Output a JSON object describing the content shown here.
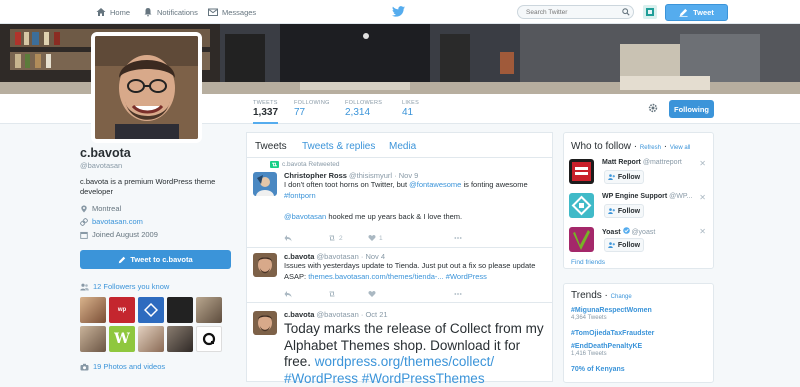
{
  "nav": {
    "home": "Home",
    "notifications": "Notifications",
    "messages": "Messages"
  },
  "search": {
    "placeholder": "Search Twitter"
  },
  "tweet_button": "Tweet",
  "stats": [
    {
      "label": "TWEETS",
      "value": "1,337"
    },
    {
      "label": "FOLLOWING",
      "value": "77"
    },
    {
      "label": "FOLLOWERS",
      "value": "2,314"
    },
    {
      "label": "LIKES",
      "value": "41"
    }
  ],
  "following_button": "Following",
  "profile": {
    "name": "c.bavota",
    "handle": "@bavotasan",
    "bio": "c.bavota is a premium WordPress theme developer",
    "location": "Montreal",
    "website": "bavotasan.com",
    "joined": "Joined August 2009",
    "tweet_to": "Tweet to c.bavota",
    "followers_you_know": "12 Followers you know",
    "photos_videos": "19 Photos and videos"
  },
  "tabs": [
    "Tweets",
    "Tweets & replies",
    "Media"
  ],
  "tweets": [
    {
      "retweeted_by": "c.bavota Retweeted",
      "name": "Christopher Ross",
      "handle": "@thisismyurl",
      "time": "Nov 9",
      "text_a": "I don't often toot horns on Twitter, but ",
      "link_a": "@fontawesome",
      "text_b": " is fonting awesome ",
      "link_b": "#fontporn",
      "link_c": "@bavotasan",
      "text_c": " hooked me up years back & I love them.",
      "retweets": "2",
      "likes": "1"
    },
    {
      "name": "c.bavota",
      "handle": "@bavotasan",
      "time": "Nov 4",
      "text_a": "Issues with yesterdays update to Tienda. Just put out a fix so please update ASAP: ",
      "link_a": "themes.bavotasan.com/themes/tienda-...",
      "link_b": "#WordPress"
    },
    {
      "name": "c.bavota",
      "handle": "@bavotasan",
      "time": "Oct 21",
      "text_a": "Today marks the release of Collect from my Alphabet Themes shop. Download it for free. ",
      "link_a": "wordpress.org/themes/collect/",
      "link_b": "#WordPress #WordPressThemes"
    }
  ],
  "who_to_follow": {
    "title": "Who to follow",
    "refresh": "Refresh",
    "view_all": "View all",
    "follow_label": "Follow",
    "suggestions": [
      {
        "name": "Matt Report",
        "handle": "@mattreport"
      },
      {
        "name": "WP Engine Support",
        "handle": "@WP..."
      },
      {
        "name": "Yoast",
        "handle": "@yoast"
      }
    ],
    "find_friends": "Find friends"
  },
  "trends": {
    "title": "Trends",
    "change": "Change",
    "items": [
      {
        "name": "#MigunaRespectWomen",
        "count": "4,364 Tweets"
      },
      {
        "name": "#TomOjiedaTaxFraudster",
        "count": ""
      },
      {
        "name": "#EndDeathPenaltyKE",
        "count": "1,416 Tweets"
      },
      {
        "name": "70% of Kenyans",
        "count": ""
      }
    ]
  },
  "colors": {
    "accent": "#55acee",
    "link": "#3b94d9",
    "text": "#292f33",
    "muted": "#8899a6"
  }
}
